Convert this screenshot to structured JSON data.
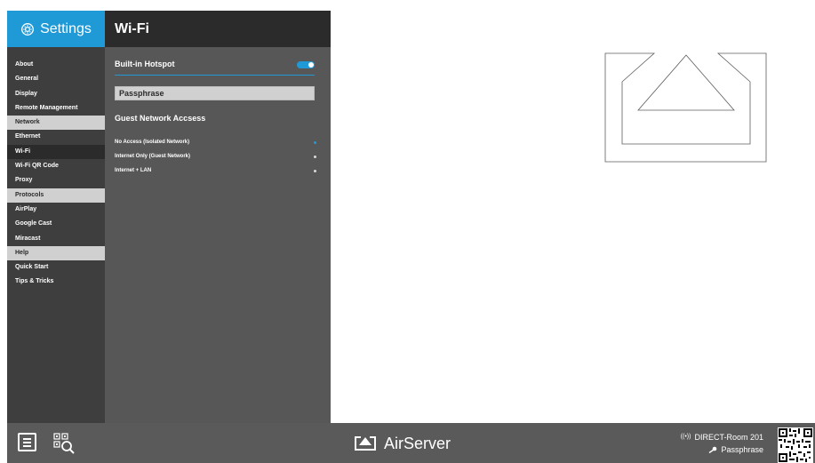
{
  "settings": {
    "title": "Settings"
  },
  "sidebar": {
    "items": [
      {
        "label": "About",
        "type": "item"
      },
      {
        "label": "General",
        "type": "item"
      },
      {
        "label": "Display",
        "type": "item"
      },
      {
        "label": "Remote Management",
        "type": "item"
      },
      {
        "label": "Network",
        "type": "section"
      },
      {
        "label": "Ethernet",
        "type": "item"
      },
      {
        "label": "Wi-Fi",
        "type": "active"
      },
      {
        "label": "Wi-Fi QR Code",
        "type": "item"
      },
      {
        "label": "Proxy",
        "type": "item"
      },
      {
        "label": "Protocols",
        "type": "section"
      },
      {
        "label": "AirPlay",
        "type": "item"
      },
      {
        "label": "Google Cast",
        "type": "item"
      },
      {
        "label": "Miracast",
        "type": "item"
      },
      {
        "label": "Help",
        "type": "section"
      },
      {
        "label": "Quick Start",
        "type": "item"
      },
      {
        "label": "Tips & Tricks",
        "type": "item"
      }
    ]
  },
  "wifi": {
    "title": "Wi-Fi",
    "hotspot_label": "Built-in Hotspot",
    "hotspot_enabled": true,
    "passphrase_placeholder": "Passphrase",
    "guest_title": "Guest Network Accsess",
    "options": [
      {
        "label": "No Access (Isolated Network)",
        "selected": true
      },
      {
        "label": "Internet Only (Guest Network)",
        "selected": false
      },
      {
        "label": "Internet + LAN",
        "selected": false
      }
    ]
  },
  "bottombar": {
    "brand": "AirServer",
    "network_name": "DIRECT-Room 201",
    "passphrase": "Passphrase"
  },
  "colors": {
    "accent": "#1f9ad6",
    "sidebar_bg": "#3e3e3e",
    "panel_bg": "#575757",
    "header_dark": "#2b2b2b",
    "section_bg": "#d0d0d0",
    "bottombar_bg": "#5a5a5a"
  },
  "icons": [
    "gear-icon",
    "airplay-icon",
    "menu-icon",
    "qr-search-icon",
    "airserver-logo-icon",
    "wireless-signal-icon",
    "key-icon",
    "qr-code"
  ]
}
